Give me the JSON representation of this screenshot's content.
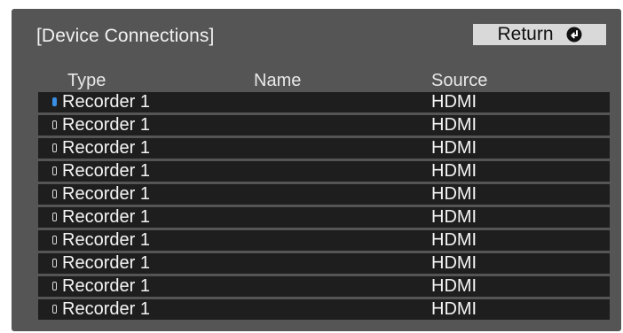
{
  "dialog": {
    "title": "[Device Connections]",
    "return_label": "Return",
    "return_icon": "enter-return-icon"
  },
  "table": {
    "columns": [
      "Type",
      "Name",
      "Source"
    ],
    "rows": [
      {
        "type": "Recorder 1",
        "name": "",
        "source": "HDMI",
        "selected": true
      },
      {
        "type": "Recorder 1",
        "name": "",
        "source": "HDMI",
        "selected": false
      },
      {
        "type": "Recorder 1",
        "name": "",
        "source": "HDMI",
        "selected": false
      },
      {
        "type": "Recorder 1",
        "name": "",
        "source": "HDMI",
        "selected": false
      },
      {
        "type": "Recorder 1",
        "name": "",
        "source": "HDMI",
        "selected": false
      },
      {
        "type": "Recorder 1",
        "name": "",
        "source": "HDMI",
        "selected": false
      },
      {
        "type": "Recorder 1",
        "name": "",
        "source": "HDMI",
        "selected": false
      },
      {
        "type": "Recorder 1",
        "name": "",
        "source": "HDMI",
        "selected": false
      },
      {
        "type": "Recorder 1",
        "name": "",
        "source": "HDMI",
        "selected": false
      },
      {
        "type": "Recorder 1",
        "name": "",
        "source": "HDMI",
        "selected": false
      }
    ]
  },
  "colors": {
    "panel_bg": "#555555",
    "row_bg": "#1e1e1e",
    "selected_marker": "#3a8ee6",
    "button_bg": "#d9d9d9"
  }
}
